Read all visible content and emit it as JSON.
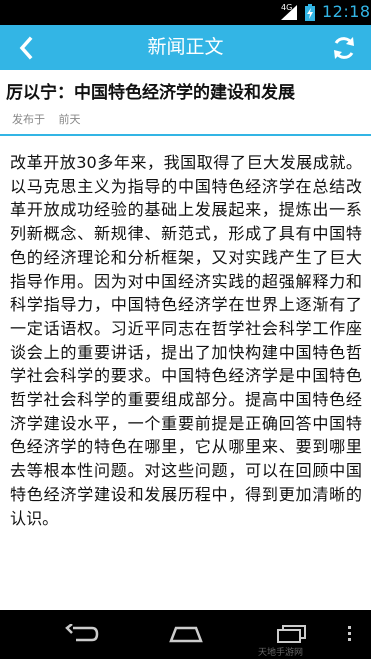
{
  "status_bar": {
    "network_label": "4G",
    "time": "12:18",
    "icons": [
      "signal-icon",
      "battery-charging-icon"
    ]
  },
  "app_bar": {
    "title": "新闻正文",
    "back_icon": "back-arrow-icon",
    "refresh_icon": "refresh-icon",
    "background_color": "#33b5e5"
  },
  "article": {
    "headline": "厉以宁：中国特色经济学的建设和发展",
    "meta_label": "发布于",
    "meta_time": "前天",
    "body": "改革开放30多年来，我国取得了巨大发展成就。以马克思主义为指导的中国特色经济学在总结改革开放成功经验的基础上发展起来，提炼出一系列新概念、新规律、新范式，形成了具有中国特色的经济理论和分析框架，又对实践产生了巨大指导作用。因为对中国经济实践的超强解释力和科学指导力，中国特色经济学在世界上逐渐有了一定话语权。习近平同志在哲学社会科学工作座谈会上的重要讲话，提出了加快构建中国特色哲学社会科学的要求。中国特色经济学是中国特色哲学社会科学的重要组成部分。提高中国特色经济学建设水平，一个重要前提是正确回答中国特色经济学的特色在哪里，它从哪里来、要到哪里去等根本性问题。对这些问题，可以在回顾中国特色经济学建设和发展历程中，得到更加清晰的认识。"
  },
  "nav_bar": {
    "buttons": [
      "back-icon",
      "home-icon",
      "recents-icon",
      "overflow-menu-icon"
    ]
  },
  "watermark": "天地手游网"
}
